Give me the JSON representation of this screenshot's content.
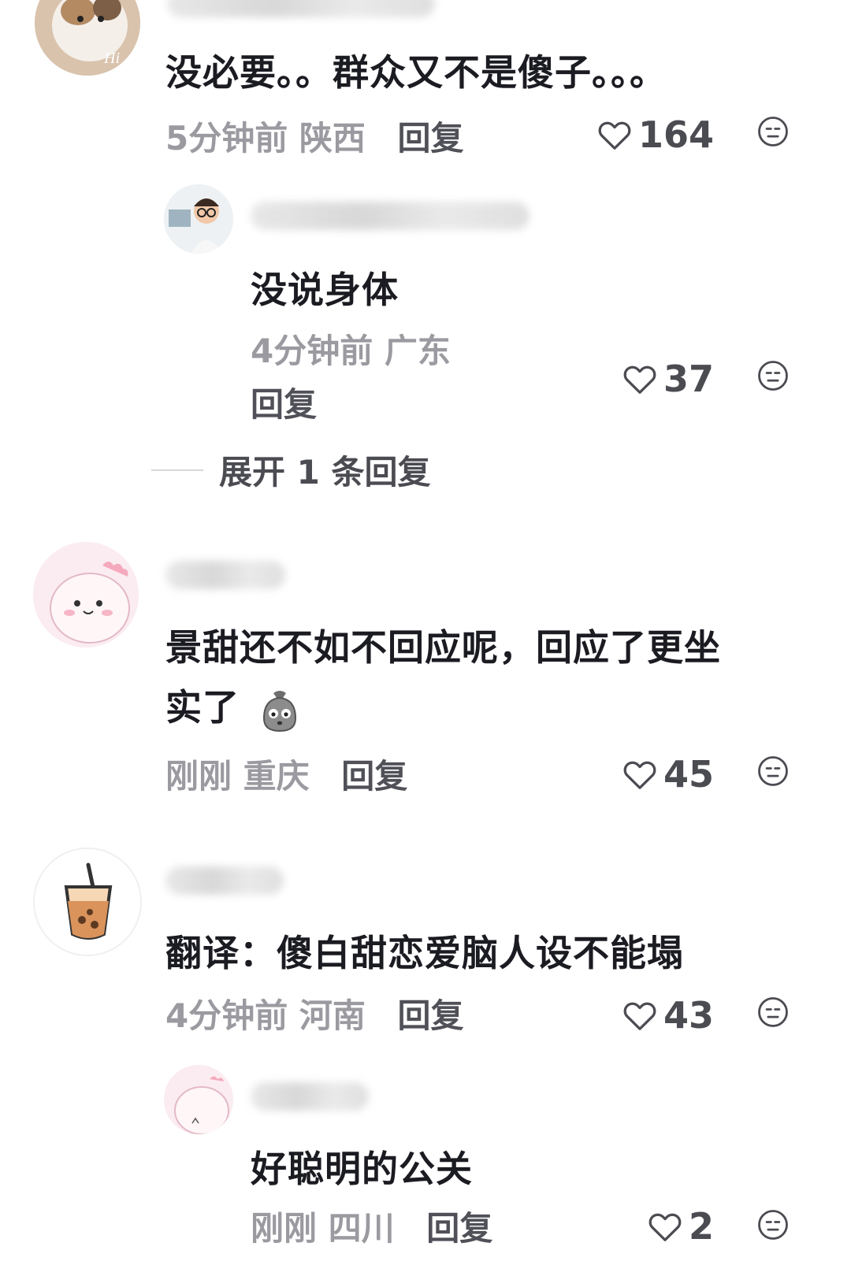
{
  "comments": [
    {
      "text": "没必要。。群众又不是傻子。。。",
      "time": "5分钟前",
      "location": "陕西",
      "reply_label": "回复",
      "likes": "164"
    },
    {
      "text": "没说身体",
      "time": "4分钟前",
      "location": "广东",
      "reply_label": "回复",
      "likes": "37"
    },
    {
      "expand_label": "展开 1 条回复"
    },
    {
      "text_line1": "景甜还不如不回应呢，回应了更坐",
      "text_line2": "实了",
      "time": "刚刚",
      "location": "重庆",
      "reply_label": "回复",
      "likes": "45"
    },
    {
      "text": "翻译：傻白甜恋爱脑人设不能塌",
      "time": "4分钟前",
      "location": "河南",
      "reply_label": "回复",
      "likes": "43"
    },
    {
      "text": "好聪明的公关",
      "time": "刚刚",
      "location": "四川",
      "reply_label": "回复",
      "likes": "2"
    }
  ],
  "icons": {
    "like": "heart-outline-icon",
    "dislike": "neutral-face-icon"
  },
  "colors": {
    "text": "#1b1b22",
    "meta": "#9a9aa0",
    "reply": "#505058"
  }
}
